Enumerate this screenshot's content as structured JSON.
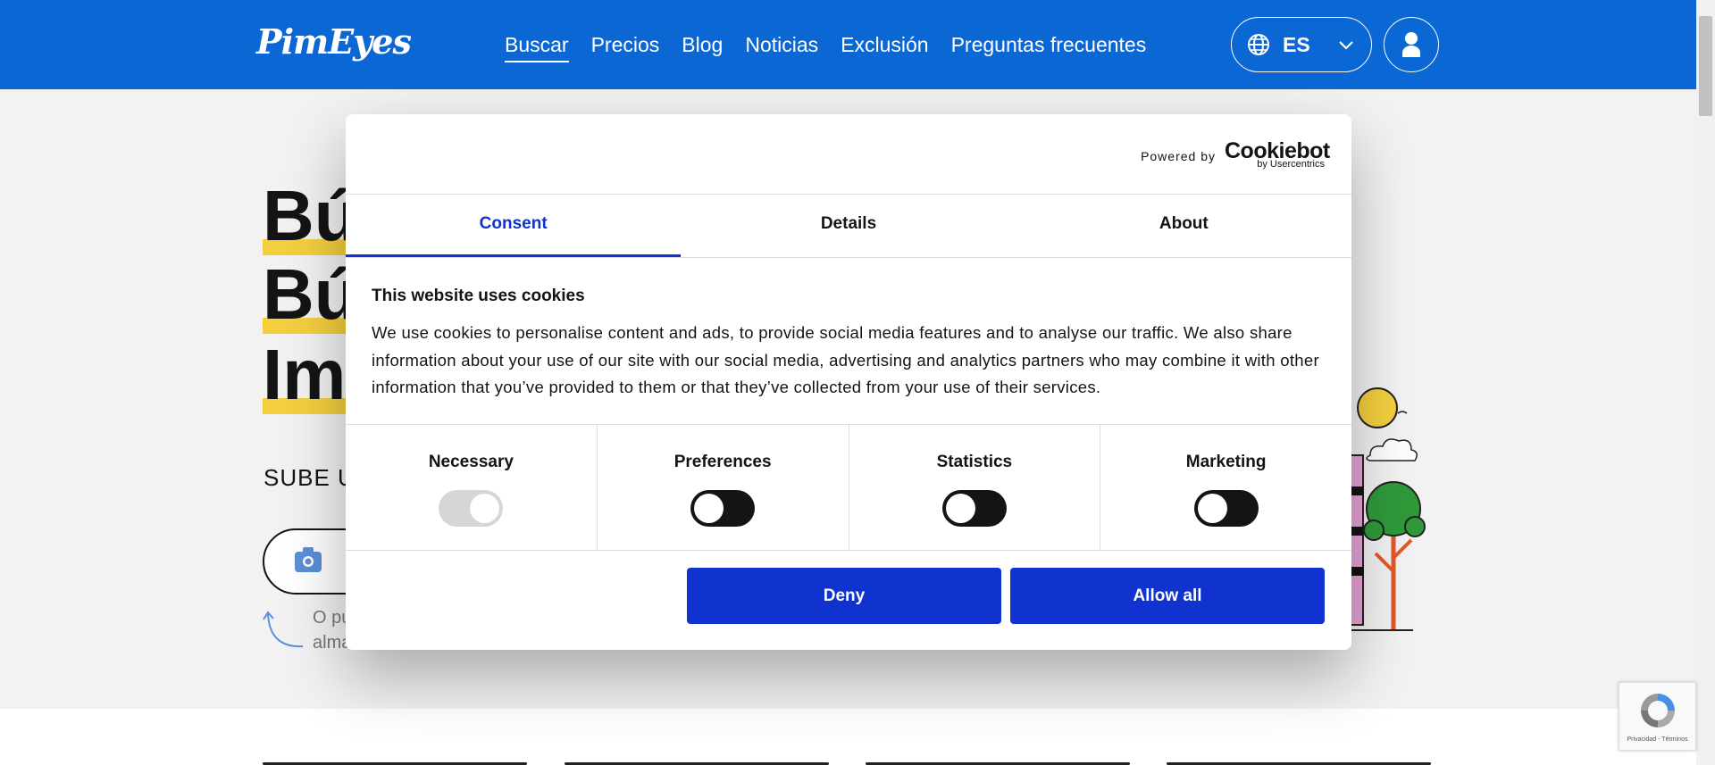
{
  "header": {
    "logo": "PimEyes",
    "nav": [
      "Buscar",
      "Precios",
      "Blog",
      "Noticias",
      "Exclusión",
      "Preguntas frecuentes"
    ],
    "lang": "ES"
  },
  "hero": {
    "title_lines": [
      "Bú",
      "Bú",
      "Im"
    ],
    "subtitle": "SUBE UI",
    "note_lines": [
      "O pu",
      "alma"
    ]
  },
  "consent": {
    "powered_by": "Powered by",
    "brand": "Cookiebot",
    "brand_sub": "by Usercentrics",
    "tabs": [
      "Consent",
      "Details",
      "About"
    ],
    "title": "This website uses cookies",
    "body": "We use cookies to personalise content and ads, to provide social media features and to analyse our traffic. We also share information about your use of our site with our social media, advertising and analytics partners who may combine it with other information that you’ve provided to them or that they’ve collected from your use of their services.",
    "categories": [
      {
        "label": "Necessary",
        "enabled": true,
        "disabled": true
      },
      {
        "label": "Preferences",
        "enabled": false
      },
      {
        "label": "Statistics",
        "enabled": false
      },
      {
        "label": "Marketing",
        "enabled": false
      }
    ],
    "deny": "Deny",
    "allow_all": "Allow all"
  },
  "recaptcha": {
    "text": "Privacidad - Términos"
  },
  "colors": {
    "header": "#0b67d4",
    "accent": "#1032cf",
    "highlight": "#f4cf3e"
  }
}
